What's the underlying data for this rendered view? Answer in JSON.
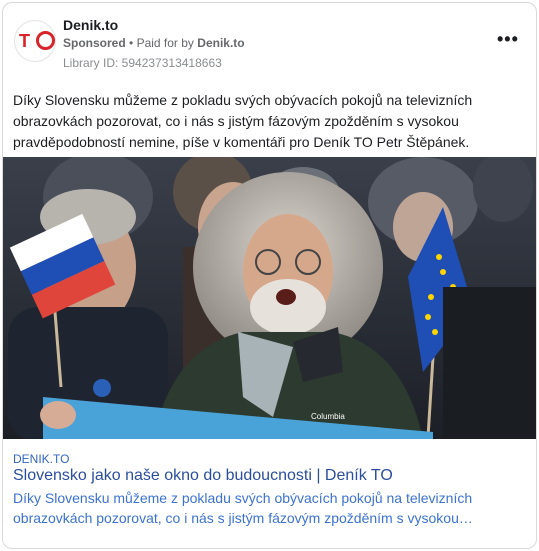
{
  "post": {
    "page_name": "Denik.to",
    "sponsored": "Sponsored",
    "separator": "•",
    "paid_for_by": "Paid for by",
    "funder": "Denik.to",
    "library_id": "Library ID: 594237313418663",
    "more_icon": "more-horizontal-icon",
    "text_line1": "Díky Slovensku můžeme z pokladu svých obývacích pokojů na televizních",
    "text_line2": "obrazovkách pozorovat, co i nás s jistým fázovým zpožděním s vysokou",
    "text_line3": "pravděpodobností nemine, píše v komentáři pro Deník TO Petr Štěpánek."
  },
  "link": {
    "domain": "DENIK.TO",
    "title": "Slovensko jako naše okno do budoucnosti | Deník TO",
    "desc_line1": "Díky Slovensku můžeme z pokladu svých obývacích pokojů na televizních",
    "desc_line2": "obrazovkách pozorovat, co i nás s jistým fázovým zpožděním s vysokou…"
  },
  "photo": {
    "jacket_brand": "Columbia"
  },
  "colors": {
    "brand_red": "#d8232a",
    "link_blue": "#3b73d0",
    "eu_blue": "#1f4fb5",
    "eu_star": "#ffd400"
  }
}
